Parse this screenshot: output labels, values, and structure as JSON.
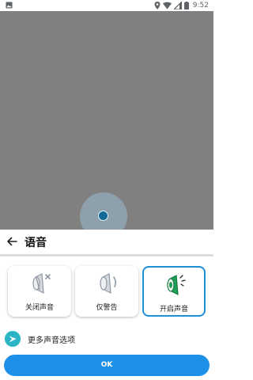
{
  "status_bar": {
    "time": "9:52",
    "icons": [
      "image-icon",
      "location-icon",
      "wifi-icon",
      "signal-icon",
      "battery-icon"
    ]
  },
  "map": {
    "background_color": "#808080",
    "location_marker": "current-location-dot"
  },
  "sheet": {
    "title": "语音",
    "back_icon": "arrow-left-icon",
    "options": [
      {
        "label": "关闭声音",
        "icon": "speaker-muted-icon",
        "selected": false
      },
      {
        "label": "仅警告",
        "icon": "speaker-alert-icon",
        "selected": false
      },
      {
        "label": "开启声音",
        "icon": "speaker-on-icon",
        "selected": true
      }
    ],
    "more_options": {
      "label": "更多声音选项",
      "icon": "navigation-sound-icon"
    },
    "ok_button": {
      "label": "OK"
    }
  },
  "colors": {
    "accent": "#1e90e8",
    "selected_border": "#1e90d8",
    "speaker_on": "#1fa157",
    "more_icon_bg": "#2bb4c6"
  }
}
